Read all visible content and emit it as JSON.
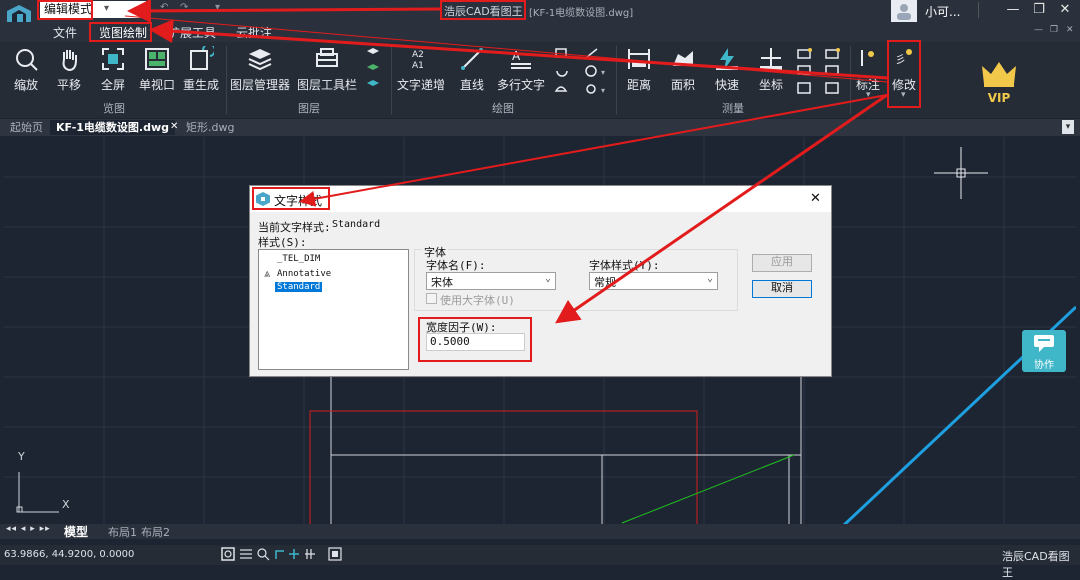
{
  "titlebar": {
    "mode": "编辑模式",
    "app_name": "浩辰CAD看图王",
    "file_name": "[KF-1电缆数设图.dwg]",
    "user_name": "小可...",
    "minimize": "—",
    "restore": "❐",
    "close": "✕",
    "sub_min": "—",
    "sub_restore": "❐",
    "sub_close": "✕"
  },
  "menu": {
    "file": "文件",
    "view_draw": "览图绘制",
    "extensions": "扩展工具",
    "cloud": "云批注"
  },
  "ribbon": {
    "view": {
      "group": "览图",
      "zoom": "缩放",
      "pan": "平移",
      "fullscreen": "全屏",
      "single_view": "单视口",
      "regen": "重生成"
    },
    "layers": {
      "group": "图层",
      "layer_manager": "图层管理器",
      "layer_toolbar": "图层工具栏"
    },
    "draw": {
      "group": "绘图",
      "text_inc": "文字递增",
      "line": "直线",
      "mtext": "多行文字"
    },
    "measure": {
      "group": "测量",
      "distance": "距离",
      "area": "面积",
      "quick": "快速",
      "coord": "坐标"
    },
    "annotate": "标注",
    "modify": "修改",
    "vip": "VIP"
  },
  "tabs": {
    "start": "起始页",
    "active": "KF-1电缆数设图.dwg",
    "rect": "矩形.dwg",
    "close": "✕"
  },
  "canvas": {
    "side_button": "协作",
    "axis_y": "Y",
    "axis_x": "X"
  },
  "layout_tabs": {
    "nav": "◂◂ ◂ ▸ ▸▸",
    "model": "模型",
    "layout1": "布局1",
    "layout2": "布局2"
  },
  "status": {
    "coords": "63.9866, 44.9200, 0.0000",
    "brand": "浩辰CAD看图王"
  },
  "dialog": {
    "title": "文字样式",
    "close": "✕",
    "current_label": "当前文字样式:",
    "current_value": "Standard",
    "styles_label": "样式(S):",
    "styles": [
      "_TEL_DIM",
      "Annotative",
      "Standard"
    ],
    "selected_style": "Standard",
    "font_group": "字体",
    "font_name_label": "字体名(F):",
    "font_name_value": "宋体",
    "font_style_label": "字体样式(Y):",
    "font_style_value": "常规",
    "bigfont_label": "使用大字体(U)",
    "width_label": "宽度因子(W):",
    "width_value": "0.5000",
    "apply": "应用",
    "cancel": "取消"
  },
  "colors": {
    "annotation_red": "#e21c1c",
    "selection_blue": "#0078d7",
    "accent_cyan": "#3fb7c8",
    "vip_gold": "#f2c84b"
  }
}
